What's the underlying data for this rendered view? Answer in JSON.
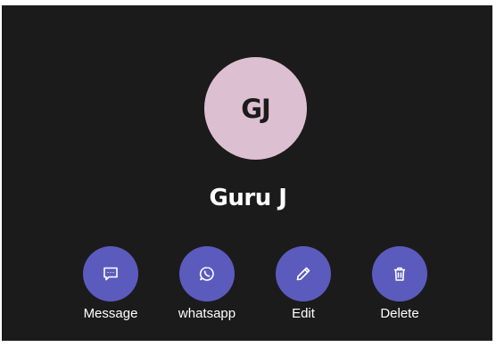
{
  "contact": {
    "initials": "GJ",
    "name": "Guru J",
    "avatar_color": "#ddbfd2"
  },
  "actions": [
    {
      "label": "Message",
      "icon": "message-icon"
    },
    {
      "label": "whatsapp",
      "icon": "whatsapp-icon"
    },
    {
      "label": "Edit",
      "icon": "pencil-icon"
    },
    {
      "label": "Delete",
      "icon": "trash-icon"
    }
  ],
  "colors": {
    "background": "#1b1b1b",
    "action_button": "#5b5bbd",
    "text": "#ffffff"
  }
}
